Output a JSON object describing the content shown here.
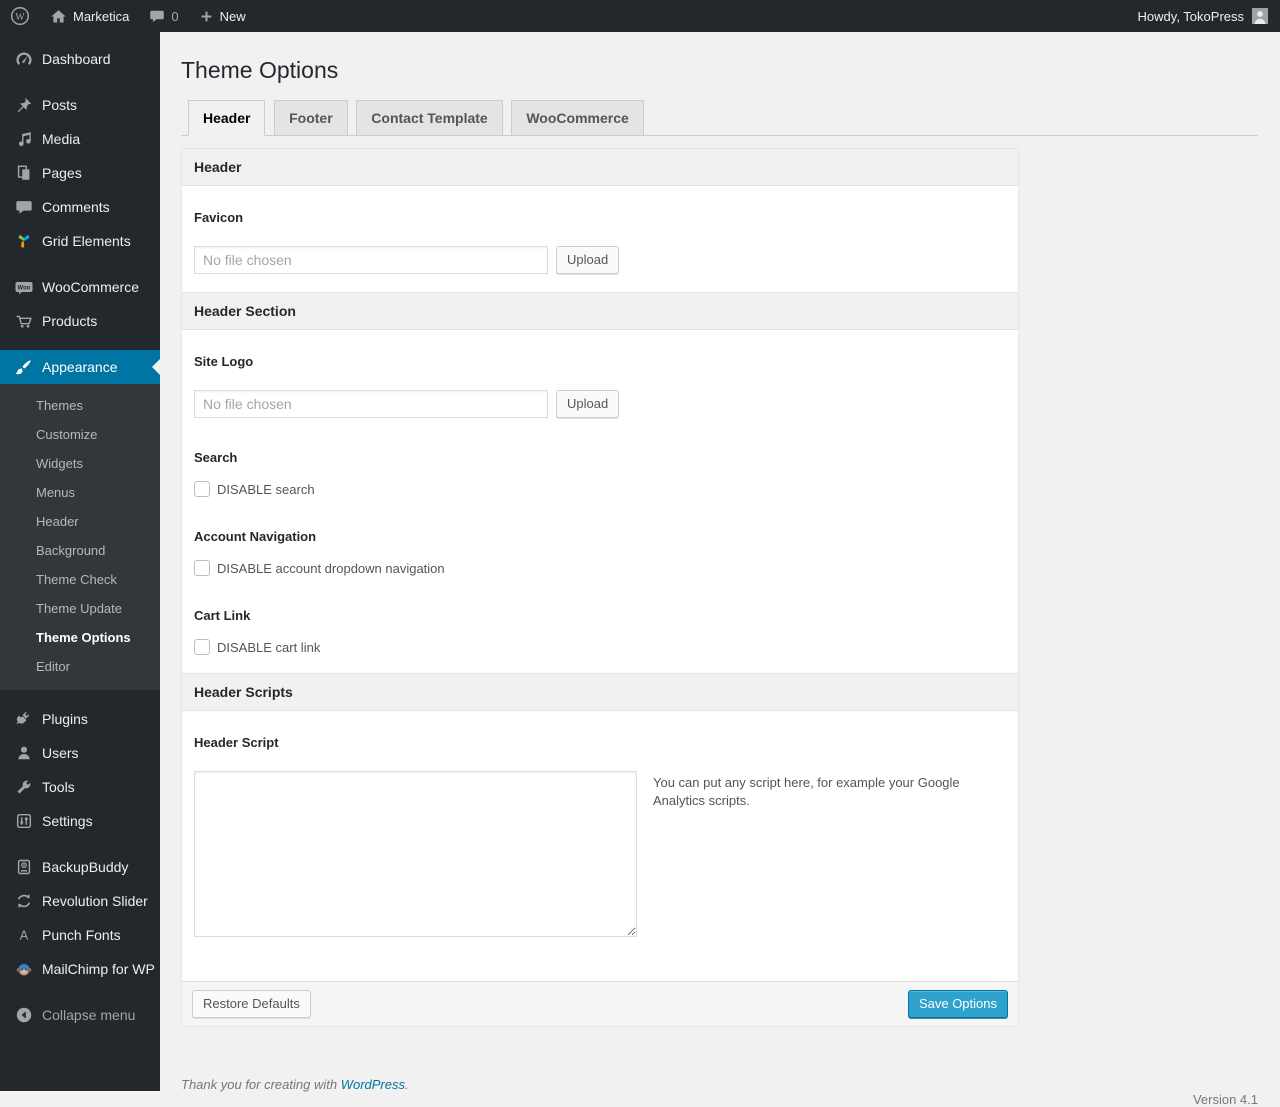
{
  "colors": {
    "admin_dark": "#23282d",
    "submenu_bg": "#32373c",
    "highlight_blue": "#0074a2",
    "primary_button": "#2ea2cc",
    "page_background": "#f1f1f1",
    "link": "#0074a2"
  },
  "admin_bar": {
    "site_name": "Marketica",
    "comment_count": "0",
    "new_label": "New",
    "howdy": "Howdy, TokoPress",
    "icons": [
      "wordpress-logo-icon",
      "home-icon",
      "comment-bubble-icon",
      "plus-icon",
      "avatar"
    ]
  },
  "sidebar": {
    "items": [
      {
        "label": "Dashboard",
        "icon": "dashboard-icon"
      },
      {
        "label": "Posts",
        "icon": "pushpin-icon"
      },
      {
        "label": "Media",
        "icon": "media-note-icon"
      },
      {
        "label": "Pages",
        "icon": "pages-icon"
      },
      {
        "label": "Comments",
        "icon": "comments-icon"
      },
      {
        "label": "Grid Elements",
        "icon": "grid-elements-icon"
      },
      {
        "label": "WooCommerce",
        "icon": "woocommerce-icon"
      },
      {
        "label": "Products",
        "icon": "cart-icon"
      },
      {
        "label": "Appearance",
        "icon": "paintbrush-icon",
        "active": true
      },
      {
        "label": "Plugins",
        "icon": "plugin-icon"
      },
      {
        "label": "Users",
        "icon": "user-icon"
      },
      {
        "label": "Tools",
        "icon": "wrench-icon"
      },
      {
        "label": "Settings",
        "icon": "sliders-icon"
      },
      {
        "label": "BackupBuddy",
        "icon": "backup-drive-icon"
      },
      {
        "label": "Revolution Slider",
        "icon": "circular-arrows-icon"
      },
      {
        "label": "Punch Fonts",
        "icon": "letter-a-icon"
      },
      {
        "label": "MailChimp for WP",
        "icon": "monkey-icon"
      },
      {
        "label": "Collapse menu",
        "icon": "collapse-arrow-icon"
      }
    ],
    "appearance_submenu": [
      "Themes",
      "Customize",
      "Widgets",
      "Menus",
      "Header",
      "Background",
      "Theme Check",
      "Theme Update",
      "Theme Options",
      "Editor"
    ],
    "active_item": "Appearance",
    "active_submenu": "Theme Options"
  },
  "main": {
    "title": "Theme Options",
    "tabs": [
      {
        "label": "Header",
        "active": true
      },
      {
        "label": "Footer",
        "active": false
      },
      {
        "label": "Contact Template",
        "active": false
      },
      {
        "label": "WooCommerce",
        "active": false
      }
    ],
    "sections": {
      "header": {
        "title": "Header"
      },
      "favicon": {
        "label": "Favicon",
        "placeholder": "No file chosen",
        "value": "",
        "upload_label": "Upload"
      },
      "header_section": {
        "title": "Header Section"
      },
      "site_logo": {
        "label": "Site Logo",
        "placeholder": "No file chosen",
        "value": "",
        "upload_label": "Upload"
      },
      "search": {
        "label": "Search",
        "checkbox_label": "DISABLE search",
        "checked": false
      },
      "account_navigation": {
        "label": "Account Navigation",
        "checkbox_label": "DISABLE account dropdown navigation",
        "checked": false
      },
      "cart_link": {
        "label": "Cart Link",
        "checkbox_label": "DISABLE cart link",
        "checked": false
      },
      "header_scripts": {
        "title": "Header Scripts"
      },
      "header_script": {
        "label": "Header Script",
        "value": "",
        "help": "You can put any script here, for example your Google Analytics scripts."
      }
    },
    "actions": {
      "restore_label": "Restore Defaults",
      "save_label": "Save Options"
    }
  },
  "page_footer": {
    "thanks_text": "Thank you for creating with",
    "link_label": "WordPress",
    "period": ".",
    "version": "Version 4.1"
  }
}
